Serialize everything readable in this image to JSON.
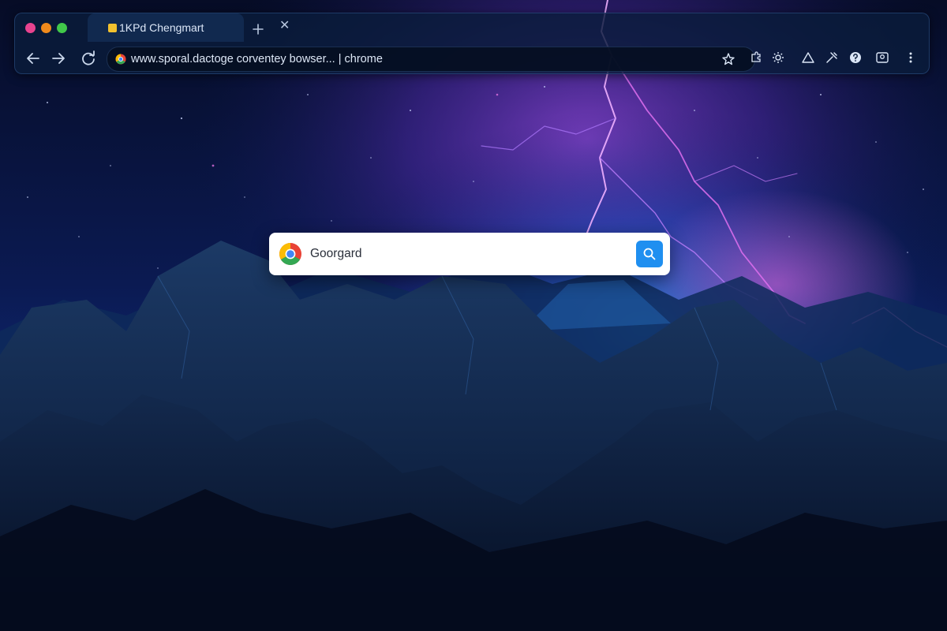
{
  "window": {
    "traffic_lights": [
      "#e8438f",
      "#f08a1c",
      "#41c84a"
    ]
  },
  "tab": {
    "title": "1KPd Chengmart",
    "close_glyph": "✕",
    "favicon_color": "#f2c12e"
  },
  "toolbar": {
    "back_icon": "arrow-left-icon",
    "forward_icon": "arrow-right-icon",
    "reload_icon": "reload-icon",
    "url": "www.sporal.dactoge corventey bowser... | chrome",
    "bookmark_icon": "star-icon",
    "extensions": [
      "puzzle-icon",
      "gear-icon",
      "triangle-icon",
      "tools-icon",
      "help-icon",
      "profile-icon"
    ],
    "menu_icon": "more-vert-icon"
  },
  "search": {
    "value": "Goorgard",
    "button_color": "#1f8ff0"
  },
  "colors": {
    "accent": "#1f8ff0",
    "frame_bg": "#0a1c3a"
  }
}
